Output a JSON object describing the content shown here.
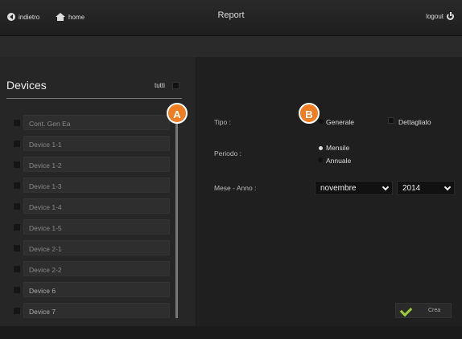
{
  "header": {
    "back_label": "indietro",
    "home_label": "home",
    "title": "Report",
    "logout_label": "logout"
  },
  "devices": {
    "title": "Devices",
    "select_all_label": "tutti",
    "items": [
      {
        "label": "Cont. Gen Ea"
      },
      {
        "label": "Device 1-1"
      },
      {
        "label": "Device 1-2"
      },
      {
        "label": "Device 1-3"
      },
      {
        "label": "Device 1-4"
      },
      {
        "label": "Device 1-5"
      },
      {
        "label": "Device 2-1"
      },
      {
        "label": "Device 2-2"
      },
      {
        "label": "Device 6"
      },
      {
        "label": "Device 7"
      }
    ]
  },
  "form": {
    "tipo_label": "Tipo :",
    "tipo_options": [
      "Generale",
      "Dettagliato"
    ],
    "periodo_label": "Periodo :",
    "periodo_options": [
      "Mensile",
      "Annuale"
    ],
    "periodo_selected": "Mensile",
    "mese_anno_label": "Mese - Anno :",
    "month_value": "novembre",
    "year_value": "2014",
    "create_label": "Crea"
  },
  "annotations": {
    "a": "A",
    "b": "B",
    "color": "#ef7d22"
  }
}
